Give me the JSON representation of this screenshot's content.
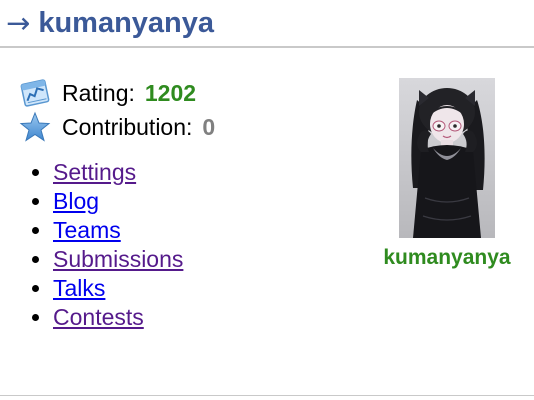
{
  "header": {
    "arrow": "→",
    "handle": "kumanyanya"
  },
  "stats": {
    "rating_label": "Rating:",
    "rating_value": "1202",
    "rating_icon": "rating-chart-icon",
    "contribution_label": "Contribution:",
    "contribution_value": "0",
    "contribution_icon": "star-icon"
  },
  "menu": {
    "items": [
      {
        "label": "Settings",
        "visited": true
      },
      {
        "label": "Blog",
        "visited": false
      },
      {
        "label": "Teams",
        "visited": false
      },
      {
        "label": "Submissions",
        "visited": true
      },
      {
        "label": "Talks",
        "visited": false
      },
      {
        "label": "Contests",
        "visited": true
      }
    ]
  },
  "profile": {
    "handle": "kumanyanya"
  },
  "colors": {
    "title": "#3b5998",
    "rating_green": "#2f8b1f",
    "contribution_gray": "#808080",
    "link": "#0000ee",
    "link_visited": "#551a8b"
  }
}
